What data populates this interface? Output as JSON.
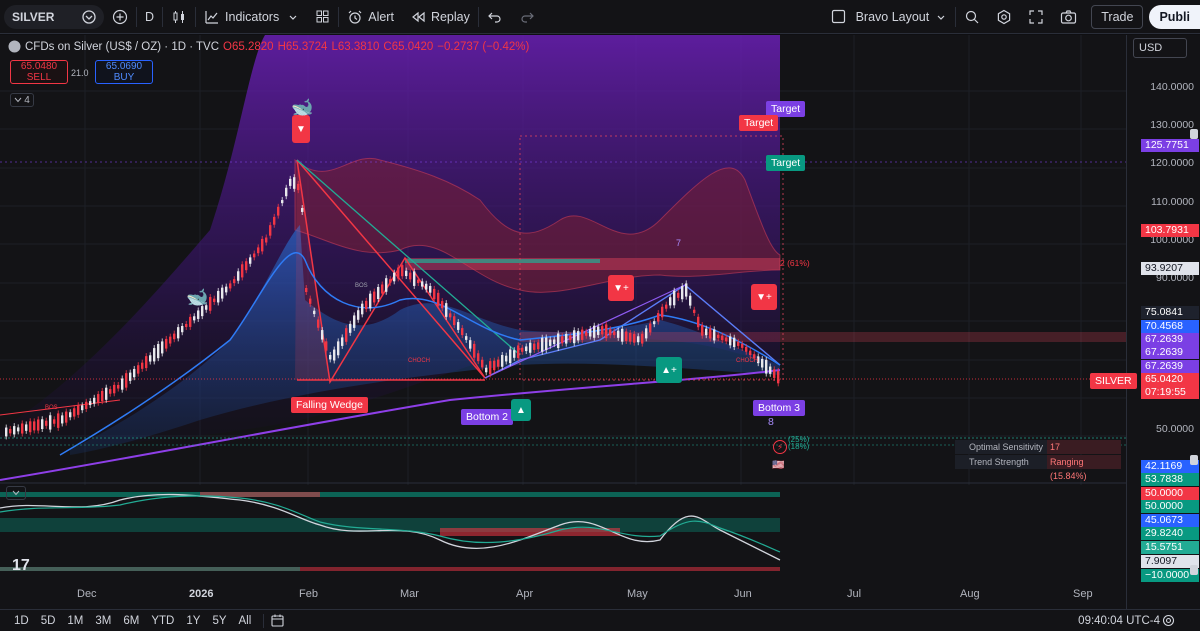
{
  "toolbar": {
    "symbol": "SILVER",
    "interval": "D",
    "indicators_label": "Indicators",
    "alert_label": "Alert",
    "replay_label": "Replay",
    "layout_name": "Bravo Layout",
    "trade_label": "Trade",
    "publish_label": "Publi"
  },
  "legend": {
    "title": "CFDs on Silver (US$ / OZ) · 1D · TVC",
    "open": "O65.2820",
    "high": "H65.3724",
    "low": "L63.3810",
    "close": "C65.0420",
    "change": "−0.2737 (−0.42%)",
    "sell_price": "65.0480",
    "sell_label": "SELL",
    "spread": "21.0",
    "buy_price": "65.0690",
    "buy_label": "BUY",
    "indicator_count": "4"
  },
  "currency": "USD",
  "price_axis": {
    "labels": [
      "140.0000",
      "130.0000",
      "120.0000",
      "110.0000",
      "100.0000",
      "90.0000",
      "50.0000"
    ],
    "tags": [
      {
        "text": "125.7751",
        "color": "#7b3fe4"
      },
      {
        "text": "103.7931",
        "color": "#f23645"
      },
      {
        "text": "93.9207",
        "color": "#e0e3eb"
      },
      {
        "text": "75.0841",
        "color": "#1e222d"
      },
      {
        "text": "70.4568",
        "color": "#2962ff"
      },
      {
        "text": "67.2639",
        "color": "#7b3fe4"
      },
      {
        "text": "67.2639",
        "color": "#7b3fe4"
      },
      {
        "text": "67.2639",
        "color": "#7b3fe4"
      },
      {
        "text": "65.0420",
        "color": "#f23645"
      },
      {
        "text": "07:19:55",
        "color": "#f23645"
      },
      {
        "text": "42.1169",
        "color": "#2962ff"
      },
      {
        "text": "53.7838",
        "color": "#089981"
      },
      {
        "text": "50.0000",
        "color": "#f23645"
      },
      {
        "text": "50.0000",
        "color": "#089981"
      },
      {
        "text": "45.0673",
        "color": "#2962ff"
      },
      {
        "text": "29.8240",
        "color": "#089981"
      },
      {
        "text": "15.5751",
        "color": "#22ab94"
      },
      {
        "text": "7.9097",
        "color": "#e0e3eb"
      },
      {
        "text": "−10.0000",
        "color": "#089981"
      }
    ],
    "symbol_tag": "SILVER"
  },
  "x_axis": [
    "Dec",
    "2026",
    "Feb",
    "Mar",
    "Apr",
    "May",
    "Jun",
    "Jul",
    "Aug",
    "Sep"
  ],
  "annotations": {
    "target_1": "Target",
    "target_2": "Target",
    "target_3": "Target",
    "falling_wedge": "Falling Wedge",
    "bottom_2": "Bottom 2",
    "bottom_3": "Bottom 3",
    "fib_label": "2 (61%)",
    "fib_25": "(25%)",
    "fib_18": "(18%)",
    "count_8": "8",
    "count_7": "7",
    "bos_1": "BOS",
    "bos_2": "BOS",
    "choch_1": "CHOCH",
    "choch_2": "CHOCH"
  },
  "info_panel": {
    "sensitivity_label": "Optimal Sensitivity",
    "sensitivity_value": "17",
    "trend_label": "Trend Strength",
    "trend_value": "Ranging (15.84%)"
  },
  "bottom": {
    "ranges": [
      "1D",
      "5D",
      "1M",
      "3M",
      "6M",
      "YTD",
      "1Y",
      "5Y",
      "All"
    ],
    "clock": "09:40:04 UTC-4"
  },
  "colors": {
    "up": "#089981",
    "down": "#f23645",
    "accent_purple": "#7b3fe4",
    "accent_blue": "#2962ff"
  }
}
